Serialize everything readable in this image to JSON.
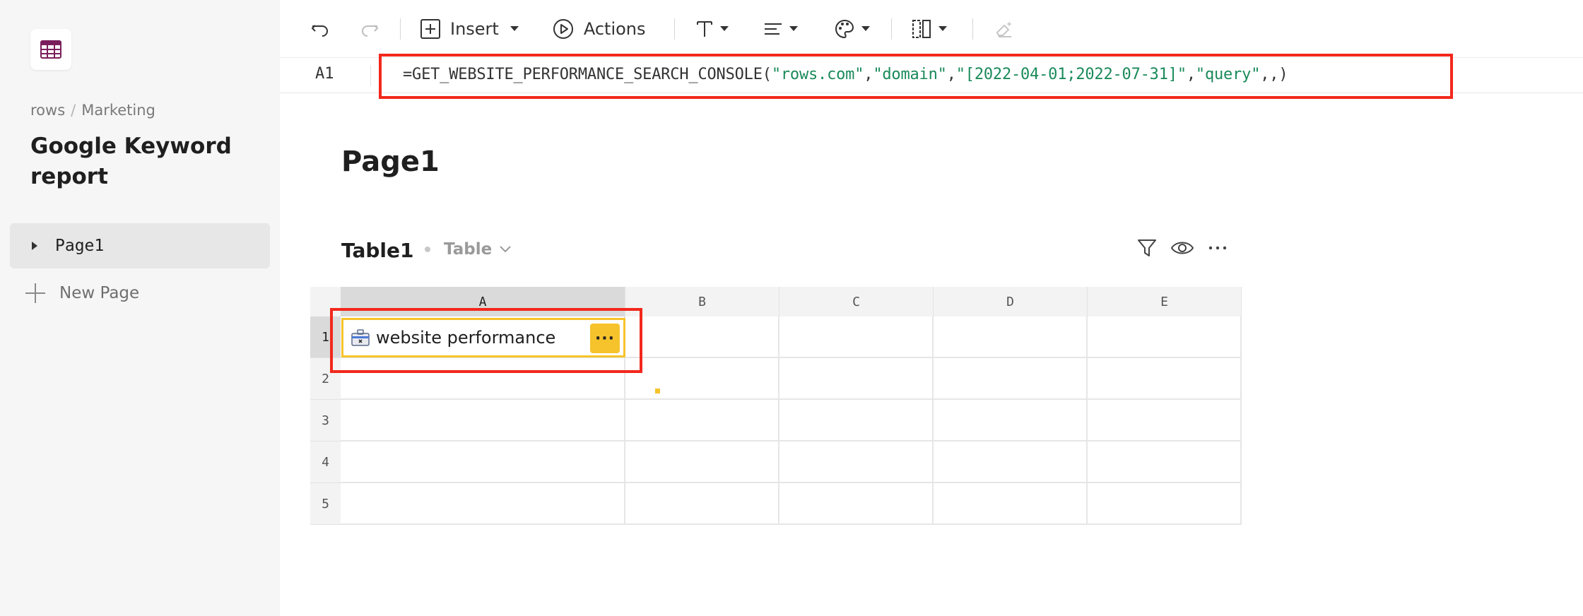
{
  "sidebar": {
    "breadcrumb": [
      "rows",
      "Marketing"
    ],
    "doc_title": "Google Keyword report",
    "pages": [
      {
        "label": "Page1"
      }
    ],
    "new_page_label": "New Page"
  },
  "toolbar": {
    "insert_label": "Insert",
    "actions_label": "Actions"
  },
  "formula_bar": {
    "cell_ref": "A1",
    "formula_parts": [
      {
        "t": "=GET_WEBSITE_PERFORMANCE_SEARCH_CONSOLE(",
        "s": false
      },
      {
        "t": "\"rows.com\"",
        "s": true
      },
      {
        "t": ",",
        "s": false
      },
      {
        "t": "\"domain\"",
        "s": true
      },
      {
        "t": ",",
        "s": false
      },
      {
        "t": "\"[2022-04-01;2022-07-31]\"",
        "s": true
      },
      {
        "t": ",",
        "s": false
      },
      {
        "t": "\"query\"",
        "s": true
      },
      {
        "t": ",,)",
        "s": false
      }
    ]
  },
  "page": {
    "title": "Page1",
    "table": {
      "name": "Table1",
      "view": "Table",
      "columns": [
        "A",
        "B",
        "C",
        "D",
        "E"
      ],
      "rows": [
        "1",
        "2",
        "3",
        "4",
        "5"
      ],
      "active_cell_value": "website performance",
      "more_label": "···"
    }
  },
  "colors": {
    "accent_yellow": "#f6c32c",
    "highlight_red": "#f2281c",
    "formula_string": "#1a8a5a",
    "brand_purple": "#7a1f5c"
  }
}
